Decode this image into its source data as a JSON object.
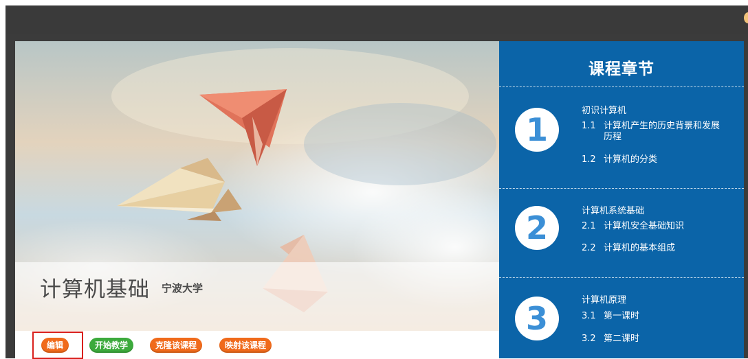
{
  "course": {
    "title": "计算机基础",
    "university": "宁波大学"
  },
  "actions": {
    "edit": "编辑",
    "start_teaching": "开始教学",
    "clone_course": "克隆该课程",
    "map_course": "映射该课程"
  },
  "chapters": {
    "heading": "课程章节",
    "items": [
      {
        "number": "1",
        "title": "初识计算机",
        "lessons": [
          {
            "num": "1.1",
            "text": "计算机产生的历史背景和发展历程"
          },
          {
            "num": "1.2",
            "text": "计算机的分类"
          }
        ]
      },
      {
        "number": "2",
        "title": "计算机系统基础",
        "lessons": [
          {
            "num": "2.1",
            "text": "计算机安全基础知识"
          },
          {
            "num": "2.2",
            "text": "计算机的基本组成"
          }
        ]
      },
      {
        "number": "3",
        "title": "计算机原理",
        "lessons": [
          {
            "num": "3.1",
            "text": "第一课时"
          },
          {
            "num": "3.2",
            "text": "第二课时"
          }
        ]
      }
    ]
  },
  "colors": {
    "panel_blue": "#0b64a8",
    "button_orange": "#f06a1b",
    "button_green": "#3caa3c",
    "highlight_red": "#d9201c"
  }
}
